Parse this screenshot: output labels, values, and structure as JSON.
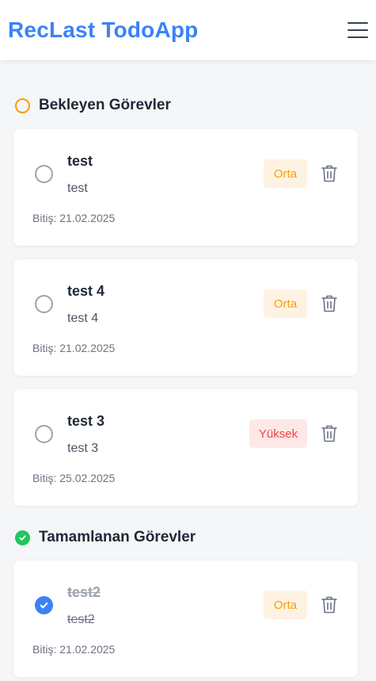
{
  "header": {
    "title": "RecLast TodoApp",
    "menu_icon": "hamburger-menu-icon"
  },
  "pending_section": {
    "title": "Bekleyen Görevler",
    "icon": "pending-circle-icon",
    "color": "#f59e0b"
  },
  "completed_section": {
    "title": "Tamamlanan Görevler",
    "icon": "check-circle-icon",
    "color": "#22c55e"
  },
  "pending_tasks": [
    {
      "title": "test",
      "description": "test",
      "priority": "Orta",
      "due": "Bitiş: 21.02.2025"
    },
    {
      "title": "test 4",
      "description": "test 4",
      "priority": "Orta",
      "due": "Bitiş: 21.02.2025"
    },
    {
      "title": "test 3",
      "description": "test 3",
      "priority": "Yüksek",
      "due": "Bitiş: 25.02.2025"
    }
  ],
  "completed_tasks": [
    {
      "title": "test2",
      "description": "test2",
      "priority": "Orta",
      "due": "Bitiş: 21.02.2025"
    }
  ],
  "colors": {
    "accent": "#3b82f6",
    "priority_medium": "#f59e0b",
    "priority_high": "#ef4444"
  }
}
